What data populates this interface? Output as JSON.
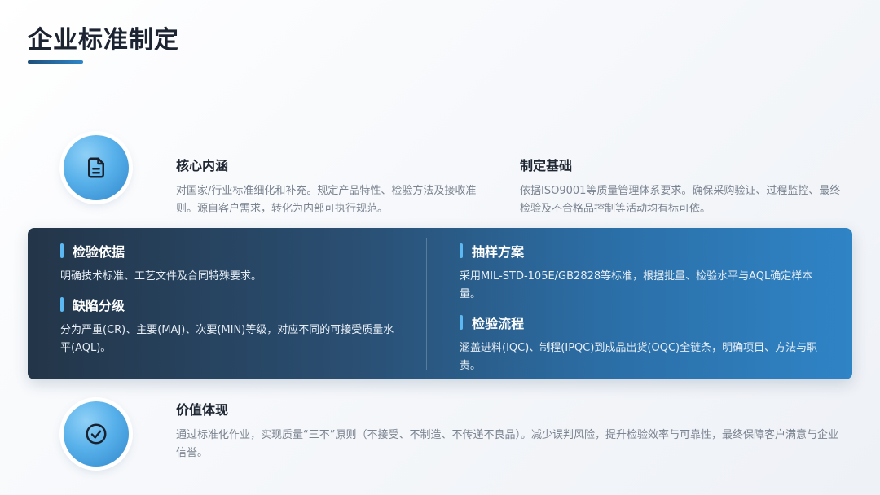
{
  "page": {
    "title": "企业标准制定"
  },
  "top_left": {
    "icon": "document-icon",
    "title": "核心内涵",
    "text": "对国家/行业标准细化和补充。规定产品特性、检验方法及接收准则。源自客户需求，转化为内部可执行规范。"
  },
  "top_right": {
    "title": "制定基础",
    "text": "依据ISO9001等质量管理体系要求。确保采购验证、过程监控、最终检验及不合格品控制等活动均有标可依。"
  },
  "band": {
    "items": [
      {
        "title": "检验依据",
        "text": "明确技术标准、工艺文件及合同特殊要求。"
      },
      {
        "title": "缺陷分级",
        "text": "分为严重(CR)、主要(MAJ)、次要(MIN)等级，对应不同的可接受质量水平(AQL)。"
      },
      {
        "title": "抽样方案",
        "text": "采用MIL-STD-105E/GB2828等标准，根据批量、检验水平与AQL确定样本量。"
      },
      {
        "title": "检验流程",
        "text": "涵盖进料(IQC)、制程(IPQC)到成品出货(OQC)全链条，明确项目、方法与职责。"
      }
    ]
  },
  "bottom": {
    "icon": "check-circle-icon",
    "title": "价值体现",
    "text": "通过标准化作业，实现质量“三不”原则（不接受、不制造、不传递不良品）。减少误判风险，提升检验效率与可靠性，最终保障客户满意与企业信誉。"
  },
  "colors": {
    "accent": "#2f86c8",
    "band_start": "#233548",
    "band_end": "#2f84c6"
  }
}
